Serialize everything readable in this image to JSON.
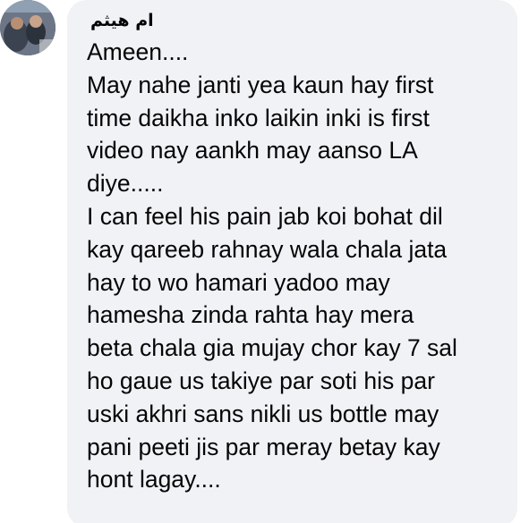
{
  "comment": {
    "author": "ام هيثم",
    "lines": [
      "Ameen....",
      "May nahe janti yea kaun hay first",
      "time daikha inko laikin inki is first",
      "video nay aankh may aanso LA",
      "diye.....",
      "I can feel his pain jab koi bohat dil",
      "kay qareeb rahnay wala chala jata",
      "hay to wo hamari yadoo may",
      "hamesha zinda rahta hay mera",
      "beta chala gia mujay chor kay 7 sal",
      "ho gaue us takiye par soti his par",
      "uski akhri sans nikli us bottle may",
      "pani peeti jis par meray betay kay",
      "hont lagay...."
    ]
  },
  "colors": {
    "bubble_background": "#f0f2f5",
    "text": "#050505"
  },
  "icons": {
    "avatar": "profile-photo"
  }
}
